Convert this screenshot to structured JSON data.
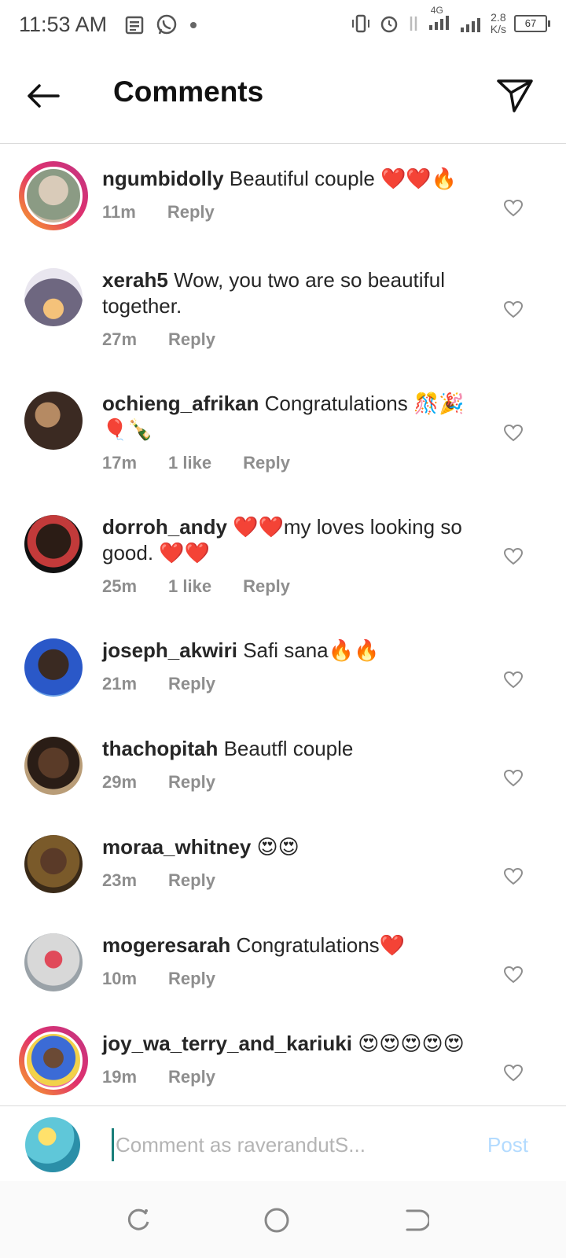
{
  "status_bar": {
    "time": "11:53 AM",
    "network": "4G",
    "speed_value": "2.8",
    "speed_unit": "K/s",
    "battery": "67"
  },
  "header": {
    "title": "Comments"
  },
  "comments": [
    {
      "username": "ngumbidolly",
      "text": "Beautiful couple ❤️❤️🔥",
      "time": "11m",
      "likes": "",
      "reply": "Reply",
      "ring": true
    },
    {
      "username": "xerah5",
      "text": "Wow, you two are so beautiful together.",
      "time": "27m",
      "likes": "",
      "reply": "Reply",
      "ring": false
    },
    {
      "username": "ochieng_afrikan",
      "text": "Congratulations 🎊🎉🎈🍾",
      "time": "17m",
      "likes": "1 like",
      "reply": "Reply",
      "ring": false
    },
    {
      "username": "dorroh_andy",
      "text": "❤️❤️my loves looking so good. ❤️❤️",
      "time": "25m",
      "likes": "1 like",
      "reply": "Reply",
      "ring": false
    },
    {
      "username": "joseph_akwiri",
      "text": "Safi sana🔥🔥",
      "time": "21m",
      "likes": "",
      "reply": "Reply",
      "ring": false
    },
    {
      "username": "thachopitah",
      "text": "Beautfl couple",
      "time": "29m",
      "likes": "",
      "reply": "Reply",
      "ring": false
    },
    {
      "username": "moraa_whitney",
      "text": "😍😍",
      "time": "23m",
      "likes": "",
      "reply": "Reply",
      "ring": false
    },
    {
      "username": "mogeresarah",
      "text": "Congratulations❤️",
      "time": "10m",
      "likes": "",
      "reply": "Reply",
      "ring": false
    },
    {
      "username": "joy_wa_terry_and_kariuki",
      "text": "😍😍😍😍😍",
      "time": "19m",
      "likes": "",
      "reply": "Reply",
      "ring": true
    }
  ],
  "composer": {
    "placeholder": "Comment as raverandutS...",
    "post_label": "Post"
  },
  "colors": {
    "ring_gradient": [
      "#f9a825",
      "#e1306c",
      "#c13584"
    ],
    "post_disabled": "#b3dbff",
    "meta_gray": "#8e8e8e"
  }
}
